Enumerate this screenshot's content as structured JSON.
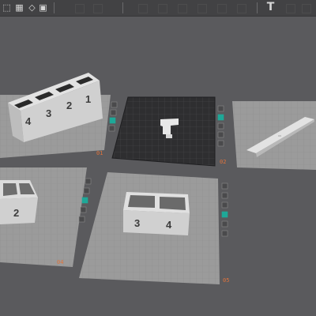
{
  "toolbar": {
    "left_icons": [
      "cube-icon",
      "grid-icon",
      "rotate-icon",
      "image-icon"
    ],
    "right_icon": "text-tool-icon",
    "text_tool_label": "T"
  },
  "colors": {
    "background": "#5a5a5d",
    "plate": "#9b9b9b",
    "plate_selected": "#2e2e30",
    "part": "#d4d4d4",
    "accent": "#1ea898",
    "plate_number": "#e0743c"
  },
  "plates": [
    {
      "id": "01",
      "number": "01",
      "selected": false,
      "parts": [
        "1",
        "2",
        "3",
        "4"
      ]
    },
    {
      "id": "02",
      "number": "02",
      "selected": true,
      "parts": []
    },
    {
      "id": "03",
      "number": "",
      "selected": false,
      "parts": []
    },
    {
      "id": "04",
      "number": "04",
      "selected": false,
      "parts": [
        "2"
      ]
    },
    {
      "id": "05",
      "number": "05",
      "selected": false,
      "parts": [
        "3",
        "4"
      ]
    }
  ]
}
